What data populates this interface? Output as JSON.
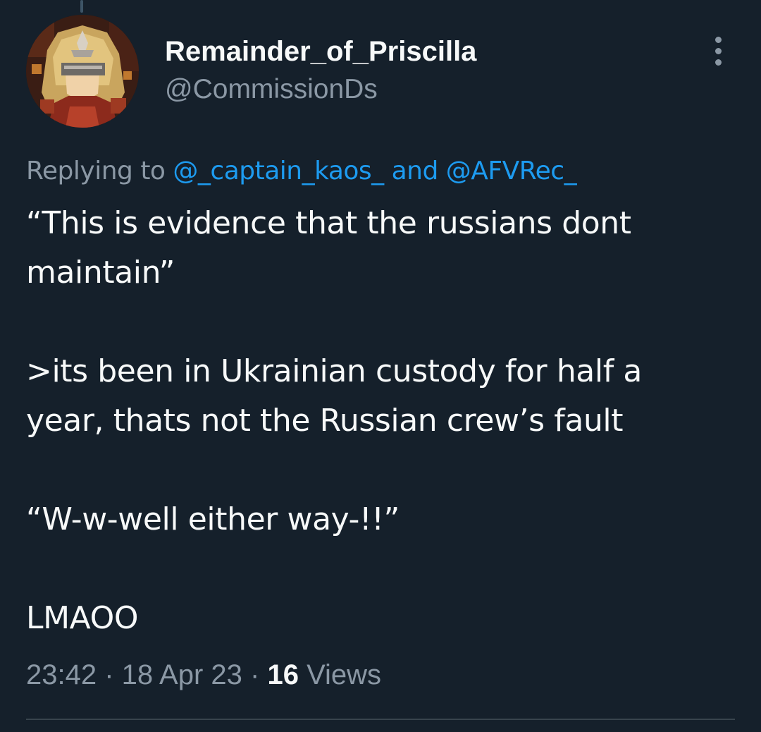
{
  "tweet": {
    "author": {
      "display_name": "Remainder_of_Priscilla",
      "handle": "@CommissionDs"
    },
    "menu_icon": "more-vertical-icon",
    "reply_context": {
      "prefix": "Replying to ",
      "mention_1": "@_captain_kaos_",
      "conjunction": " and ",
      "mention_2": "@AFVRec_"
    },
    "body": {
      "line_1": "“This is evidence that the russians dont",
      "line_2": "maintain”",
      "line_3": ">its been in Ukrainian custody for half a",
      "line_4": "year, thats not the Russian crew’s fault",
      "line_5": "“W-w-well either way-!!”",
      "line_6": "LMAOO"
    },
    "meta": {
      "time": "23:42",
      "separator": " · ",
      "date": "18 Apr 23",
      "views_count": "16",
      "views_label": " Views"
    }
  },
  "colors": {
    "background": "#15202b",
    "text_primary": "#f7f9f9",
    "text_secondary": "#8b98a5",
    "link": "#1d9bf0",
    "divider": "#38444d"
  }
}
